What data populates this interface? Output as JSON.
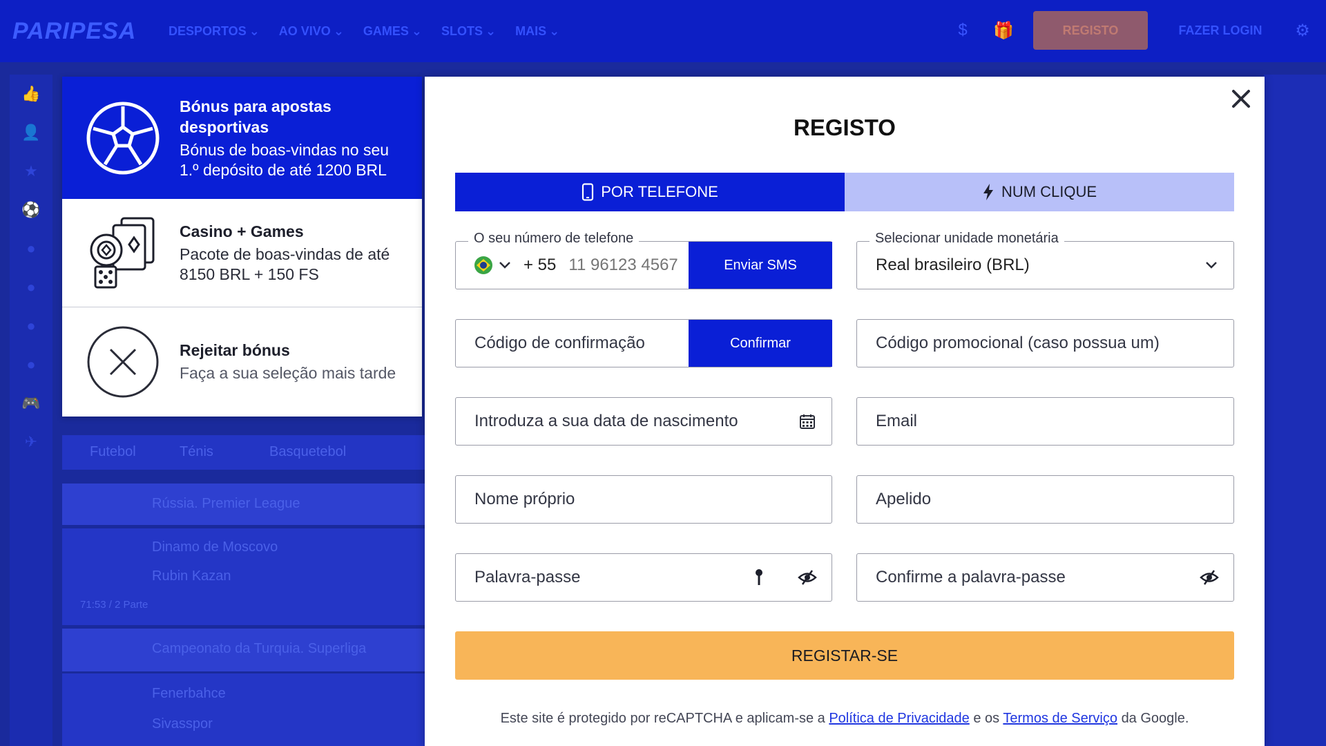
{
  "header": {
    "logo": "PARIPESA",
    "nav": [
      "DESPORTOS",
      "AO VIVO",
      "GAMES",
      "SLOTS",
      "MAIS"
    ],
    "currency_icon": "$",
    "register_label": "REGISTO",
    "login_label": "FAZER LOGIN"
  },
  "background": {
    "sports_tabs": [
      "Futebol",
      "Ténis",
      "Basquetebol"
    ],
    "league1": "Rússia. Premier League",
    "team1": "Dinamo de Moscovo",
    "team2": "Rubin Kazan",
    "match_time": "71:53 / 2 Parte",
    "league2": "Campeonato da Turquia. Superliga",
    "team3": "Fenerbahce",
    "team4": "Sivasspor"
  },
  "bonus": {
    "items": [
      {
        "title": "Bónus para apostas desportivas",
        "desc": "Bónus de boas-vindas no seu 1.º depósito de até 1200 BRL"
      },
      {
        "title": "Casino + Games",
        "desc": "Pacote de boas-vindas de até 8150 BRL + 150 FS"
      },
      {
        "title": "Rejeitar bónus",
        "desc": "Faça a sua seleção mais tarde"
      }
    ]
  },
  "modal": {
    "title": "REGISTO",
    "tab_phone": "POR TELEFONE",
    "tab_oneclick": "NUM CLIQUE",
    "phone_legend": "O seu número de telefone",
    "country_code": "+ 55",
    "phone_placeholder": "11 96123 4567",
    "send_sms": "Enviar SMS",
    "currency_legend": "Selecionar unidade monetária",
    "currency_value": "Real brasileiro (BRL)",
    "confirm_code": "Código de confirmação",
    "confirm_btn": "Confirmar",
    "promo": "Código promocional (caso possua um)",
    "birthdate": "Introduza a sua data de nascimento",
    "email": "Email",
    "first_name": "Nome próprio",
    "last_name": "Apelido",
    "password": "Palavra-passe",
    "confirm_password": "Confirme a palavra-passe",
    "submit": "REGISTAR-SE",
    "captcha_pre": "Este site é protegido por reCAPTCHA e aplicam-se a",
    "privacy": "Política de Privacidade",
    "captcha_mid": "e os",
    "terms": "Termos de Serviço",
    "captcha_post": "da Google."
  },
  "colors": {
    "primary": "#0a1fd6",
    "tab_inactive": "#b8c0f9",
    "submit": "#f8b558",
    "link": "#1f36e0"
  }
}
